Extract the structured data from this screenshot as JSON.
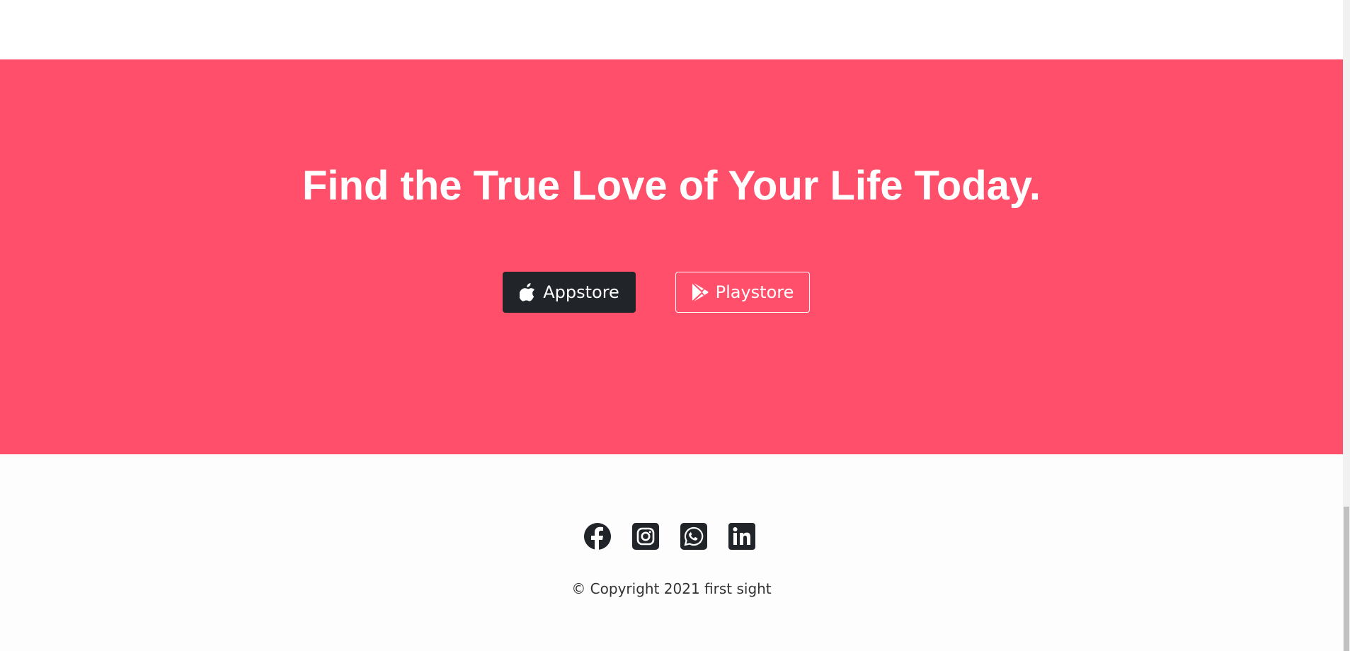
{
  "cta": {
    "title": "Find the True Love of Your Life Today.",
    "background_color": "#ff4f6a",
    "appstore_label": "Appstore",
    "appstore_icon": "apple-icon",
    "playstore_label": "Playstore",
    "playstore_icon": "play-store-icon"
  },
  "footer": {
    "social_icons": [
      "facebook-icon",
      "instagram-icon",
      "whatsapp-icon",
      "linkedin-icon"
    ],
    "copyright": "© Copyright 2021 first sight"
  }
}
